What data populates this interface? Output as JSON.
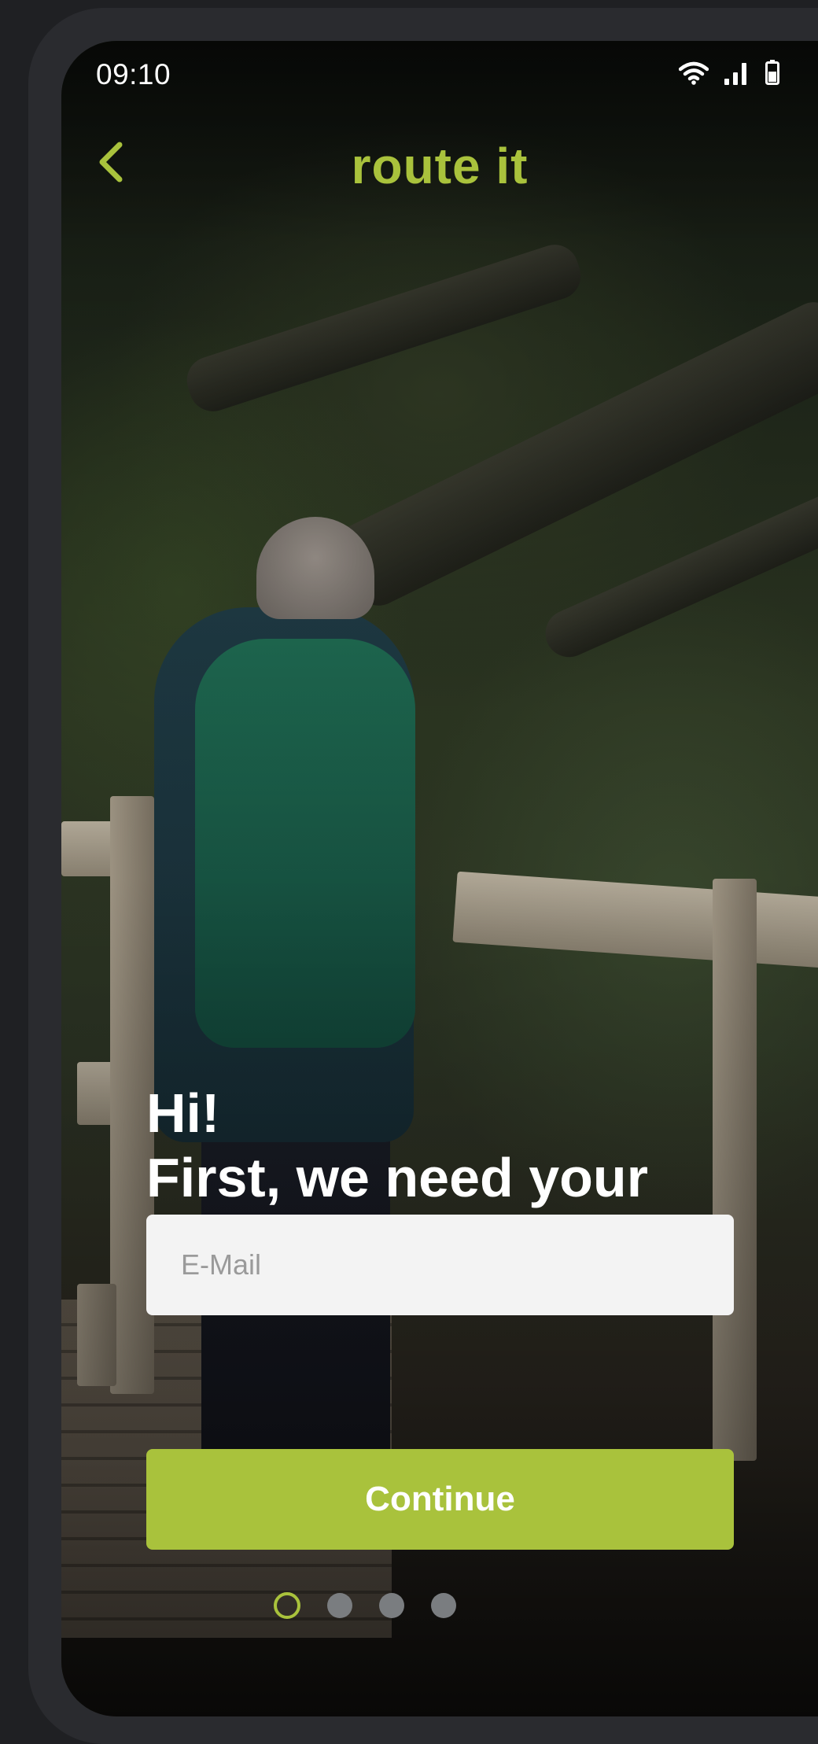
{
  "status_bar": {
    "time": "09:10",
    "icons": [
      "wifi-icon",
      "signal-icon",
      "battery-icon"
    ]
  },
  "header": {
    "back_icon": "chevron-left-icon",
    "title": "route it"
  },
  "greeting": {
    "line1": "Hi!",
    "line2": "First, we need your"
  },
  "email": {
    "placeholder": "E-Mail",
    "value": ""
  },
  "continue_button": {
    "label": "Continue"
  },
  "pagination": {
    "total": 4,
    "current": 1
  },
  "colors": {
    "accent": "#a9c23c",
    "input_bg": "#f3f3f3",
    "dot_inactive": "#7a7d80",
    "frame": "#2a2b2f",
    "page_bg": "#1f2023"
  }
}
